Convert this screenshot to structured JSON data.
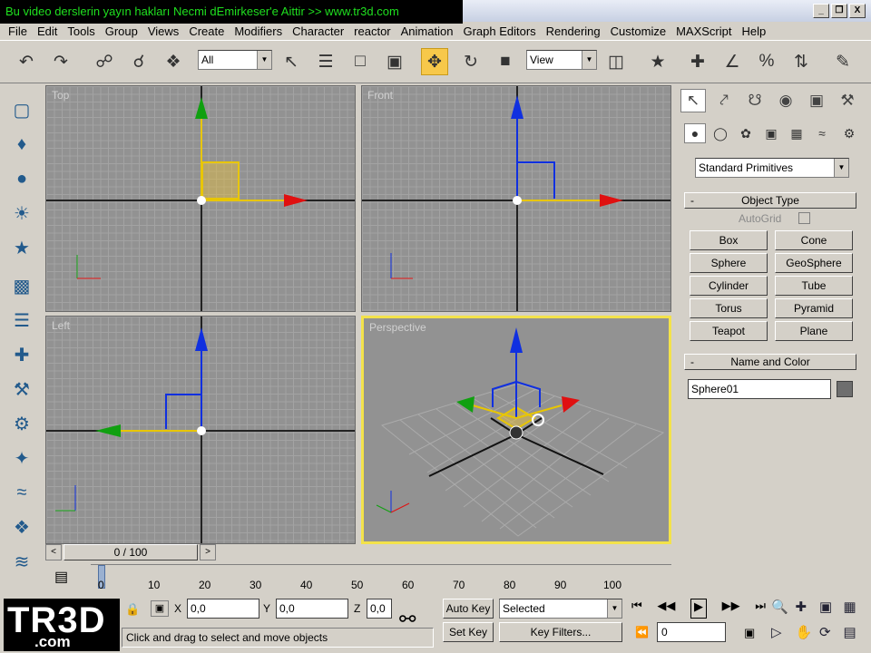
{
  "banner": "Bu video derslerin yayın hakları Necmi dEmirkeser'e Aittir >> www.tr3d.com",
  "window_controls": [
    "_",
    "❒",
    "X"
  ],
  "menu": [
    "File",
    "Edit",
    "Tools",
    "Group",
    "Views",
    "Create",
    "Modifiers",
    "Character",
    "reactor",
    "Animation",
    "Graph Editors",
    "Rendering",
    "Customize",
    "MAXScript",
    "Help"
  ],
  "toolbar": {
    "selection_filter": "All",
    "coord_system": "View"
  },
  "viewports": {
    "top": "Top",
    "front": "Front",
    "left": "Left",
    "perspective": "Perspective"
  },
  "command_panel": {
    "category": "Standard Primitives",
    "object_type_title": "Object Type",
    "autogrid_label": "AutoGrid",
    "buttons": [
      [
        "Box",
        "Cone"
      ],
      [
        "Sphere",
        "GeoSphere"
      ],
      [
        "Cylinder",
        "Tube"
      ],
      [
        "Torus",
        "Pyramid"
      ],
      [
        "Teapot",
        "Plane"
      ]
    ],
    "name_color_title": "Name and Color",
    "object_name": "Sphere01",
    "object_color": "#6e6e6e"
  },
  "timeline": {
    "slider_label": "0 / 100",
    "ticks": [
      "0",
      "10",
      "20",
      "30",
      "40",
      "50",
      "60",
      "70",
      "80",
      "90",
      "100"
    ]
  },
  "status": {
    "logo": "TR3D",
    "logo_sub": ".com",
    "x_label": "X",
    "x_value": "0,0",
    "y_label": "Y",
    "y_value": "0,0",
    "z_label": "Z",
    "z_value": "0,0",
    "prompt": "Click and drag to select and move objects",
    "auto_key": "Auto Key",
    "set_key": "Set Key",
    "key_mode": "Selected",
    "key_filters": "Key Filters...",
    "frame": "0"
  },
  "colors": {
    "active_viewport_border": "#f3e24a",
    "active_tool": "#f7c84a",
    "axis_x": "#e01010",
    "axis_y": "#10a010",
    "axis_z": "#1030e0"
  }
}
